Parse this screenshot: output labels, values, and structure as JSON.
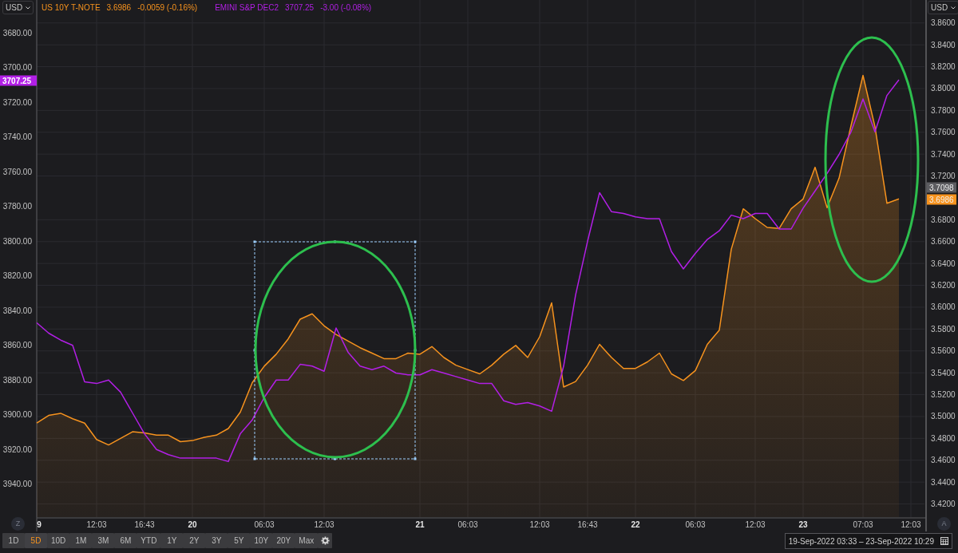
{
  "currency_left": "USD",
  "currency_right": "USD",
  "chart_data": {
    "type": "line",
    "grid": true,
    "categories": [
      "9",
      null,
      null,
      null,
      null,
      "12:03",
      null,
      null,
      null,
      "16:43",
      null,
      null,
      null,
      "20",
      null,
      null,
      null,
      null,
      null,
      "06:03",
      null,
      null,
      null,
      null,
      "12:03",
      null,
      null,
      null,
      null,
      null,
      null,
      null,
      "21",
      null,
      null,
      null,
      "06:03",
      null,
      null,
      null,
      null,
      null,
      "12:03",
      null,
      null,
      null,
      "16:43",
      null,
      null,
      null,
      "22",
      null,
      null,
      null,
      null,
      "06:03",
      null,
      null,
      null,
      null,
      "12:03",
      null,
      null,
      null,
      "23",
      null,
      null,
      null,
      null,
      "07:03",
      null,
      null,
      null,
      "12:03",
      null
    ],
    "ylim": [
      3.408,
      3.881
    ],
    "yticks": [
      {
        "value": 3.86,
        "label": "3.8600"
      },
      {
        "value": 3.84,
        "label": "3.8400"
      },
      {
        "value": 3.82,
        "label": "3.8200"
      },
      {
        "value": 3.8,
        "label": "3.8000"
      },
      {
        "value": 3.78,
        "label": "3.7800"
      },
      {
        "value": 3.76,
        "label": "3.7600"
      },
      {
        "value": 3.74,
        "label": "3.7400"
      },
      {
        "value": 3.72,
        "label": "3.7200"
      },
      {
        "value": 3.68,
        "label": "3.6800"
      },
      {
        "value": 3.66,
        "label": "3.6600"
      },
      {
        "value": 3.64,
        "label": "3.6400"
      },
      {
        "value": 3.62,
        "label": "3.6200"
      },
      {
        "value": 3.6,
        "label": "3.6000"
      },
      {
        "value": 3.58,
        "label": "3.5800"
      },
      {
        "value": 3.56,
        "label": "3.5600"
      },
      {
        "value": 3.54,
        "label": "3.5400"
      },
      {
        "value": 3.52,
        "label": "3.5200"
      },
      {
        "value": 3.5,
        "label": "3.5000"
      },
      {
        "value": 3.48,
        "label": "3.4800"
      },
      {
        "value": 3.46,
        "label": "3.4600"
      },
      {
        "value": 3.44,
        "label": "3.4400"
      },
      {
        "value": 3.42,
        "label": "3.4200"
      }
    ],
    "y2lim": [
      3959,
      3661
    ],
    "y2ticks": [
      {
        "value": 3680,
        "label": "3680.00"
      },
      {
        "value": 3700,
        "label": "3700.00"
      },
      {
        "value": 3720,
        "label": "3720.00"
      },
      {
        "value": 3740,
        "label": "3740.00"
      },
      {
        "value": 3760,
        "label": "3760.00"
      },
      {
        "value": 3780,
        "label": "3780.00"
      },
      {
        "value": 3800,
        "label": "3800.00"
      },
      {
        "value": 3820,
        "label": "3820.00"
      },
      {
        "value": 3840,
        "label": "3840.00"
      },
      {
        "value": 3860,
        "label": "3860.00"
      },
      {
        "value": 3880,
        "label": "3880.00"
      },
      {
        "value": 3900,
        "label": "3900.00"
      },
      {
        "value": 3920,
        "label": "3920.00"
      },
      {
        "value": 3940,
        "label": "3940.00"
      }
    ],
    "series": [
      {
        "name": "US 10Y T-NOTE",
        "color": "#f7931e",
        "type": "area",
        "values": [
          3.494,
          3.501,
          3.503,
          3.498,
          3.494,
          3.479,
          3.474,
          3.48,
          3.486,
          3.485,
          3.483,
          3.483,
          3.477,
          3.478,
          3.481,
          3.483,
          3.489,
          3.504,
          3.531,
          3.546,
          3.557,
          3.571,
          3.589,
          3.594,
          3.583,
          3.575,
          3.569,
          3.563,
          3.558,
          3.553,
          3.553,
          3.558,
          3.557,
          3.564,
          3.554,
          3.547,
          3.543,
          3.539,
          3.547,
          3.557,
          3.565,
          3.554,
          3.573,
          3.604,
          3.527,
          3.532,
          3.547,
          3.566,
          3.554,
          3.544,
          3.544,
          3.55,
          3.558,
          3.539,
          3.533,
          3.542,
          3.566,
          3.579,
          3.653,
          3.69,
          3.681,
          3.673,
          3.672,
          3.69,
          3.699,
          3.728,
          3.691,
          3.718,
          3.766,
          3.812,
          3.765,
          3.695,
          3.699,
          null,
          null
        ]
      },
      {
        "name": "EMINI S&P DEC2",
        "color": "#b21fe6",
        "axis": "y2",
        "values": [
          3847,
          3853,
          3857,
          3860,
          3881,
          3882,
          3880,
          3887,
          3899,
          3911,
          3920,
          3923,
          3925,
          3925,
          3925,
          3925,
          3927,
          3911,
          3903,
          3890,
          3880,
          3880,
          3871,
          3872,
          3875,
          3850,
          3864,
          3872,
          3874,
          3872,
          3876,
          3877,
          3877,
          3874,
          3876,
          3878,
          3880,
          3882,
          3882,
          3892,
          3894,
          3893,
          3895,
          3898,
          3872,
          3831,
          3800,
          3772,
          3783,
          3784,
          3786,
          3787,
          3787,
          3806,
          3816,
          3807,
          3799,
          3794,
          3785,
          3787,
          3784,
          3784,
          3793,
          3793,
          3781,
          3771,
          3761,
          3750,
          3737,
          3718,
          3737,
          3716,
          3707,
          null,
          null
        ]
      }
    ]
  },
  "left_axis_tags": [
    {
      "text": "3707.25",
      "color": "#b21fe6"
    }
  ],
  "right_axis_tags": [
    {
      "text": "3.7098",
      "color": "#5c5c60"
    },
    {
      "text": "3.6986",
      "color": "#f7931e"
    }
  ],
  "legend_readings": [
    {
      "value": "3.6986",
      "change": "-0.0059 (-0.16%)"
    },
    {
      "value": "3707.25",
      "change": "-3.00 (-0.08%)"
    }
  ],
  "zoom_button": "Z",
  "auto_button": "A",
  "range_buttons": [
    {
      "label": "1D",
      "selected": false
    },
    {
      "label": "5D",
      "selected": true
    },
    {
      "label": "10D",
      "selected": false
    },
    {
      "label": "1M",
      "selected": false
    },
    {
      "label": "3M",
      "selected": false
    },
    {
      "label": "6M",
      "selected": false
    },
    {
      "label": "YTD",
      "selected": false
    },
    {
      "label": "1Y",
      "selected": false
    },
    {
      "label": "2Y",
      "selected": false
    },
    {
      "label": "3Y",
      "selected": false
    },
    {
      "label": "5Y",
      "selected": false
    },
    {
      "label": "10Y",
      "selected": false
    },
    {
      "label": "20Y",
      "selected": false
    },
    {
      "label": "Max",
      "selected": false
    }
  ],
  "date_range": {
    "value": "19-Sep-2022 03:33 – 23-Sep-2022 10:29"
  }
}
